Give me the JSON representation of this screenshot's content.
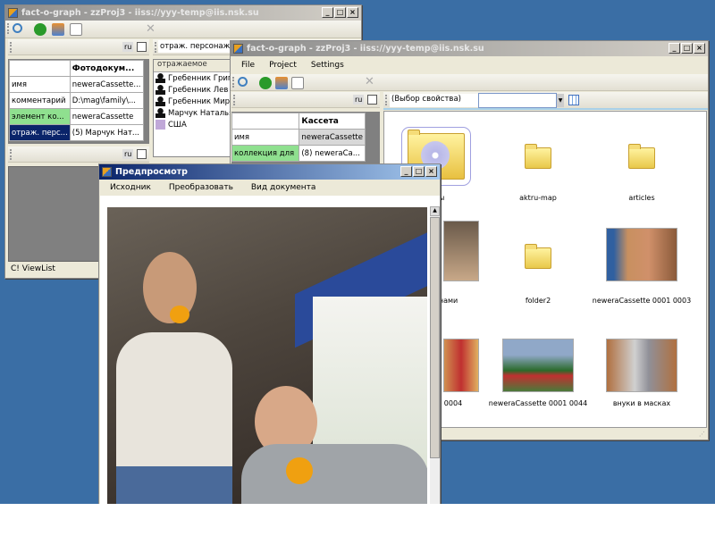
{
  "window1": {
    "title": "fact-o-graph - zzProj3 - iiss://yyy-temp@iis.nsk.su",
    "lang": "ru",
    "table": {
      "header": [
        "",
        "Фотодокум..."
      ],
      "rows": [
        [
          "имя",
          "neweraCassette..."
        ],
        [
          "комментарий",
          "D:\\mag\\family\\..."
        ],
        [
          "элемент ко...",
          "neweraCassette"
        ],
        [
          "отраж. перс...",
          "(5) Марчук Нат..."
        ]
      ]
    },
    "lang2": "ru",
    "filter_value": "отраж. персонаж",
    "list_header": "отражаемое",
    "list_items": [
      "Гребенник Григ",
      "Гребенник Лев",
      "Гребенник Мир",
      "Марчук Наталья",
      "США"
    ],
    "status": "C! ViewList"
  },
  "window2": {
    "title": "fact-o-graph - zzProj3 - iiss://yyy-temp@iis.nsk.su",
    "menu": [
      "File",
      "Project",
      "Settings"
    ],
    "lang": "ru",
    "table": {
      "header": [
        "",
        "Кассета"
      ],
      "rows": [
        [
          "имя",
          "neweraCassette"
        ],
        [
          "коллекция для",
          "(8) neweraCa..."
        ]
      ]
    },
    "property_combo": "(Выбор свойства)",
    "value_combo": "",
    "items": [
      {
        "label": "...ты",
        "type": "folder-open"
      },
      {
        "label": "aktru-map",
        "type": "folder"
      },
      {
        "label": "articles",
        "type": "folder"
      },
      {
        "label": "...льсинами",
        "type": "photo"
      },
      {
        "label": "folder2",
        "type": "folder"
      },
      {
        "label": "neweraCassette 0001 0003",
        "type": "photo"
      },
      {
        "label": "...e 0001 0004",
        "type": "photo"
      },
      {
        "label": "neweraCassette 0001 0044",
        "type": "photo"
      },
      {
        "label": "внуки в масках",
        "type": "photo"
      }
    ]
  },
  "preview": {
    "title": "Предпросмотр",
    "menu": [
      "Исходник",
      "Преобразовать",
      "Вид документа"
    ]
  }
}
